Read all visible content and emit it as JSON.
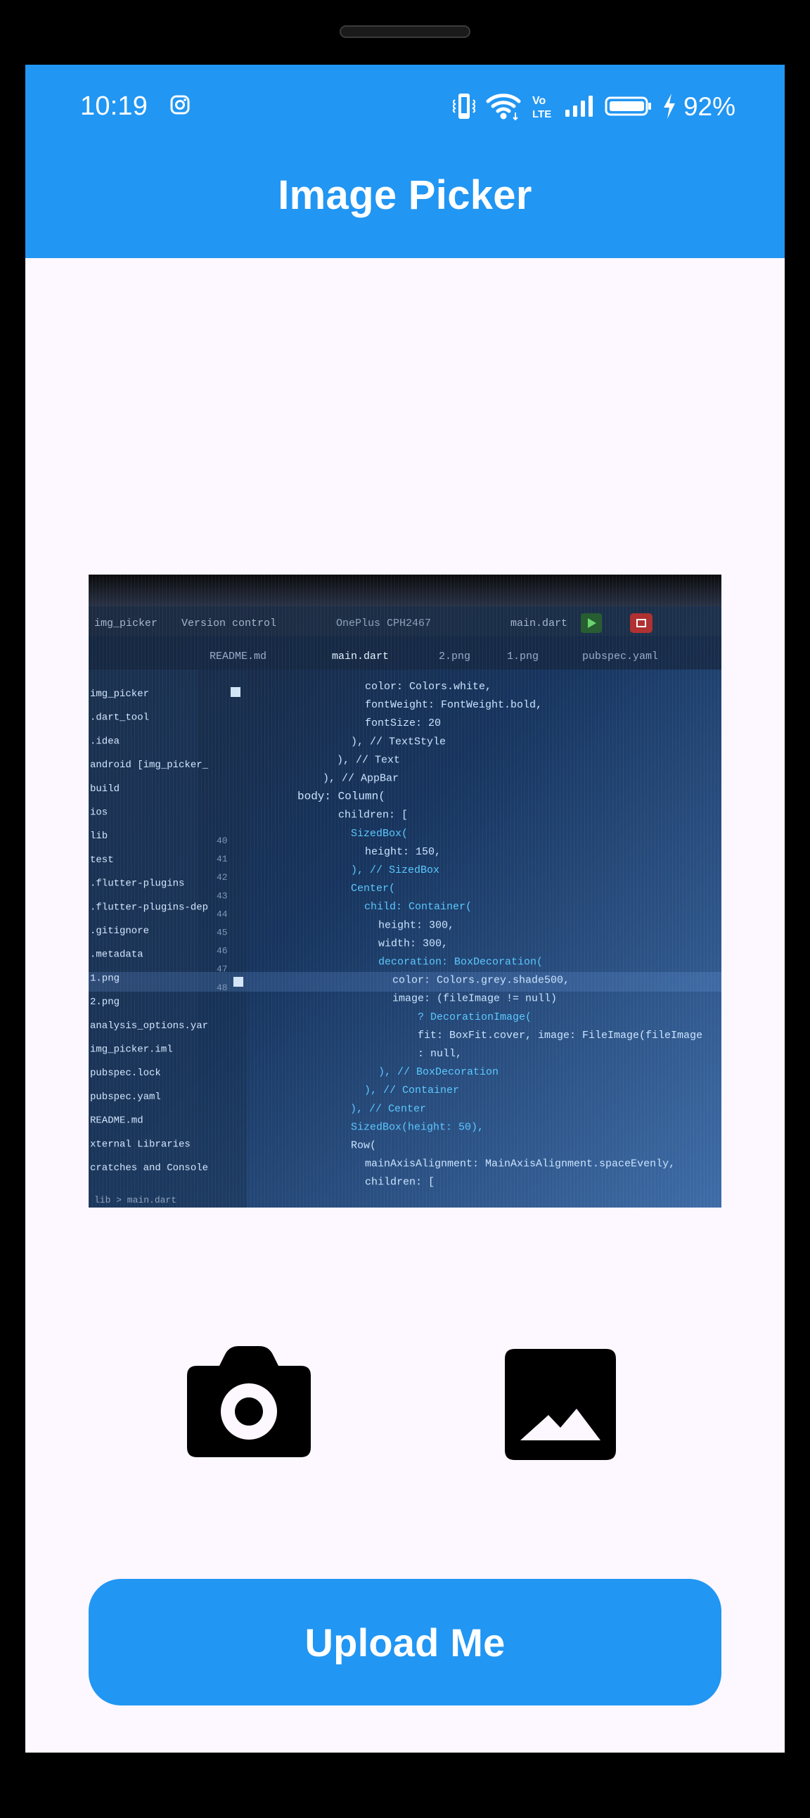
{
  "status_bar": {
    "time": "10:19",
    "network_label": "Vo LTE",
    "battery_percent": "92%"
  },
  "app_bar": {
    "title": "Image Picker"
  },
  "preview": {
    "ide_toolbar": {
      "project": "img_picker",
      "vcs": "Version control",
      "device": "OnePlus CPH2467",
      "run_config": "main.dart"
    },
    "tabs": [
      "README.md",
      "main.dart",
      "2.png",
      "1.png",
      "pubspec.yaml"
    ],
    "files": [
      "img_picker",
      ".dart_tool",
      ".idea",
      "android [img_picker_",
      "build",
      "ios",
      "lib",
      "test",
      ".flutter-plugins",
      ".flutter-plugins-dep",
      ".gitignore",
      ".metadata",
      "1.png",
      "2.png",
      "analysis_options.yar",
      "img_picker.iml",
      "pubspec.lock",
      "pubspec.yaml",
      "README.md",
      "xternal Libraries",
      "cratches and Console"
    ],
    "code_lines": [
      "color: Colors.white,",
      "fontWeight: FontWeight.bold,",
      "fontSize: 20",
      "),  // TextStyle",
      "),  // Text",
      "),  // AppBar",
      "body: Column(",
      "children: [",
      "SizedBox(",
      "height: 150,",
      "),  // SizedBox",
      "Center(",
      "child: Container(",
      "height: 300,",
      "width: 300,",
      "decoration: BoxDecoration(",
      "color: Colors.grey.shade500,",
      "image: (fileImage != null)",
      "? DecorationImage(",
      "fit: BoxFit.cover, image: FileImage(fileImage",
      ": null,",
      "),  // BoxDecoration",
      "),  // Container",
      "),  // Center",
      "SizedBox(height: 50),",
      "Row(",
      "mainAxisAlignment: MainAxisAlignment.spaceEvenly,",
      "children: ["
    ],
    "line_numbers": [
      "40",
      "41",
      "42",
      "43",
      "44",
      "45",
      "46",
      "47",
      "48"
    ],
    "breadcrumb": "lib > main.dart"
  },
  "actions": {
    "camera_icon": "camera-icon",
    "gallery_icon": "image-icon",
    "upload_label": "Upload Me"
  },
  "colors": {
    "primary": "#2196f3",
    "background": "#fdf7ff",
    "icon": "#000000"
  }
}
